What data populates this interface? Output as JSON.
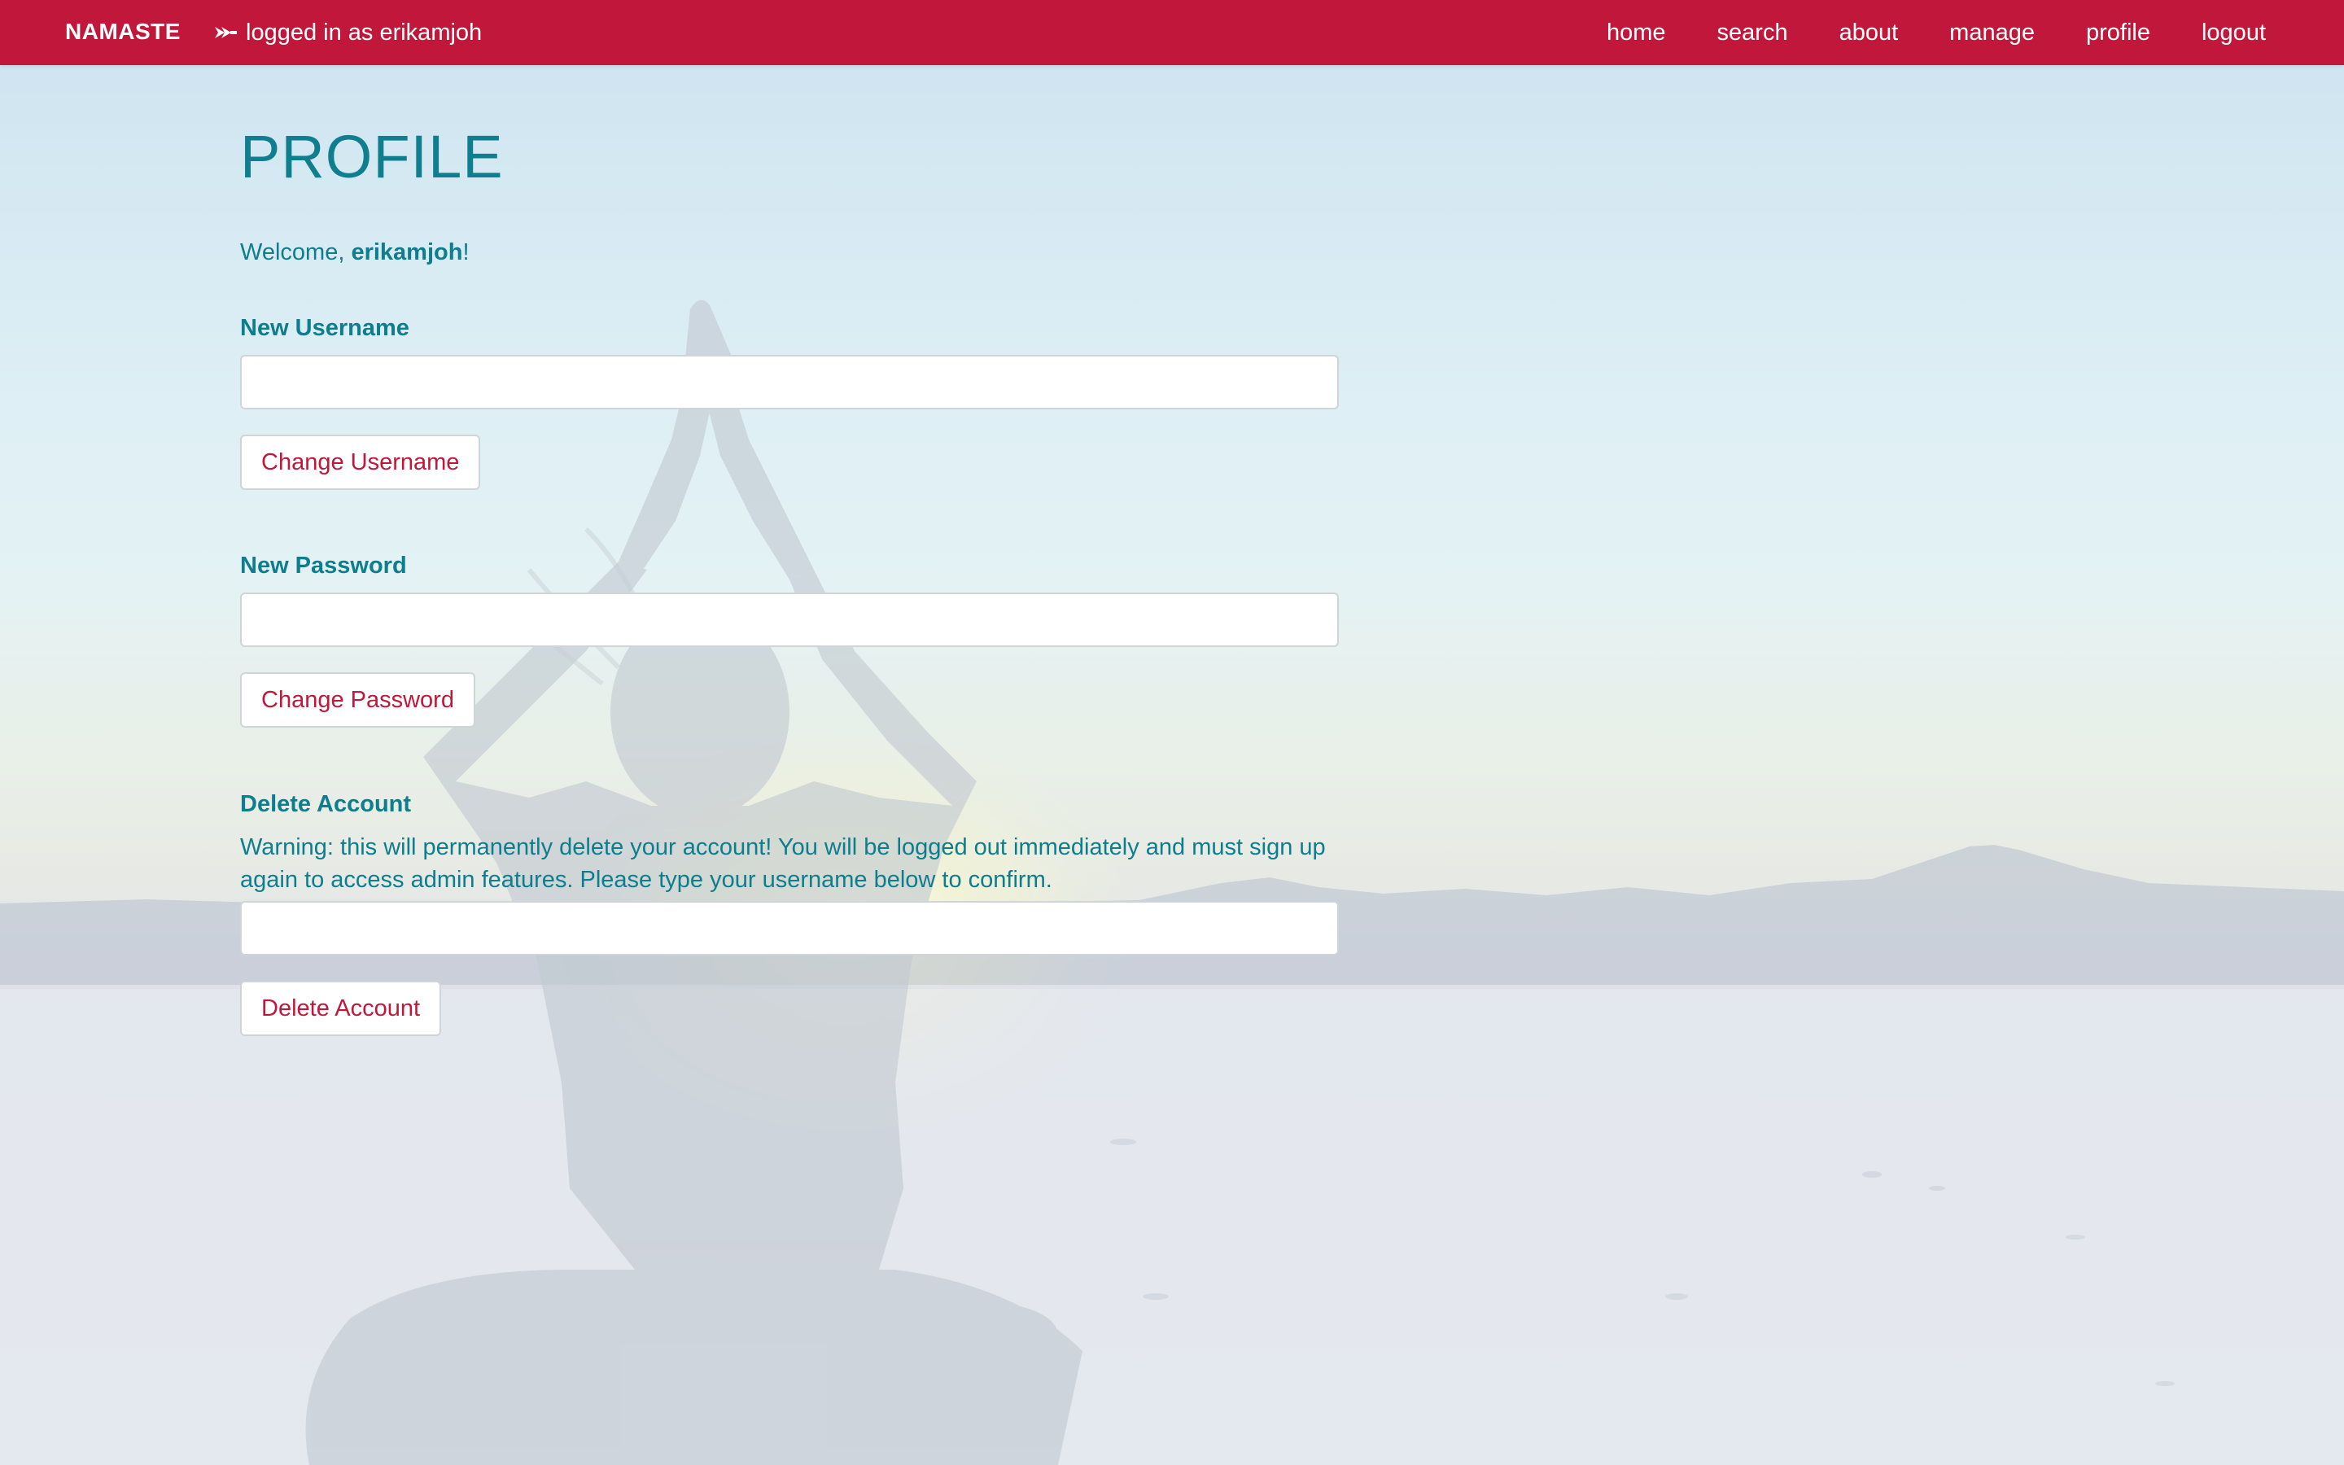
{
  "navbar": {
    "brand": "NAMASTE",
    "login_status": "logged in as erikamjoh",
    "login_icon": "sign-in-arrow-icon",
    "links": [
      {
        "label": "home"
      },
      {
        "label": "search"
      },
      {
        "label": "about"
      },
      {
        "label": "manage"
      },
      {
        "label": "profile"
      },
      {
        "label": "logout"
      }
    ]
  },
  "page": {
    "title": "PROFILE",
    "welcome_prefix": "Welcome, ",
    "welcome_user": "erikamjoh",
    "welcome_suffix": "!"
  },
  "forms": {
    "username": {
      "label": "New Username",
      "value": "",
      "button": "Change Username"
    },
    "password": {
      "label": "New Password",
      "value": "",
      "button": "Change Password"
    },
    "delete": {
      "label": "Delete Account",
      "warning": "Warning: this will permanently delete your account! You will be logged out immediately and must sign up again to access admin features. Please type your username below to confirm.",
      "value": "",
      "button": "Delete Account"
    }
  },
  "colors": {
    "navbar": "#c0173a",
    "text_teal": "#0f7f8f",
    "button_text": "#c0173a"
  }
}
